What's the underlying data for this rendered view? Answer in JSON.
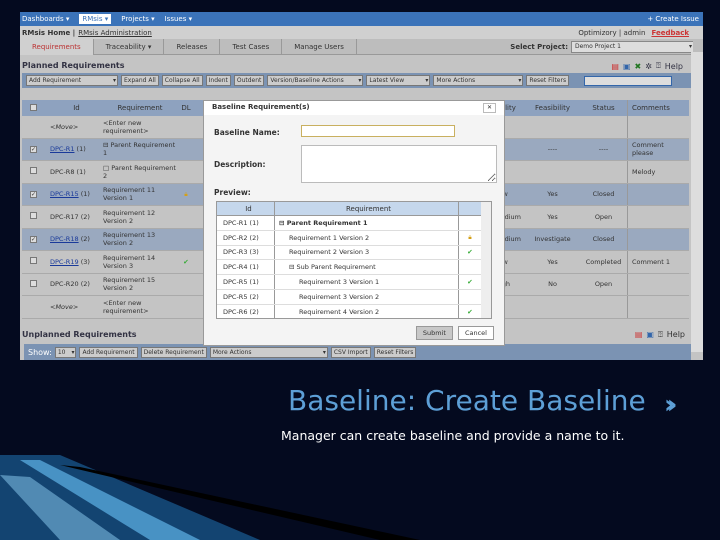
{
  "nav": {
    "items": [
      "Dashboards ▾",
      "RMsis ▾",
      "Projects ▾",
      "Issues ▾"
    ],
    "create_issue": "+ Create Issue"
  },
  "header": {
    "home": "RMsis Home",
    "admin": "RMsis Administration",
    "user": "Optimizory | admin",
    "feedback": "Feedback"
  },
  "tabs": [
    "Requirements",
    "Traceability ▾",
    "Releases",
    "Test Cases",
    "Manage Users"
  ],
  "project": {
    "label": "Select Project:",
    "value": "Demo Project 1"
  },
  "planned": {
    "title": "Planned Requirements",
    "help": "Help",
    "toolbar": {
      "add": "Add Requirement",
      "expand": "Expand All",
      "collapse": "Collapse All",
      "indent": "Indent",
      "outdent": "Outdent",
      "version": "Version/Baseline Actions",
      "view": "Latest View",
      "more": "More Actions",
      "reset": "Reset Filters"
    },
    "columns": [
      "Id",
      "Requirement",
      "DL",
      "icality",
      "Feasibility",
      "Status",
      "Comments"
    ],
    "rows": [
      {
        "id": "",
        "req": "<Enter new requirement>",
        "move": "<Move>",
        "sel": false
      },
      {
        "id": "DPC-R1",
        "ver": "(1)",
        "req": "⊟ Parent Requirement 1",
        "crit": "----",
        "feas": "----",
        "status": "----",
        "comment": "Comment please",
        "sel": true,
        "link": true
      },
      {
        "id": "DPC-R8",
        "ver": "(1)",
        "req": "□ Parent Requirement 2",
        "comment": "Melody",
        "sel": false
      },
      {
        "id": "DPC-R15",
        "ver": "(1)",
        "req": "Requirement 11 Version 1",
        "dl": "lock",
        "crit": "Low",
        "feas": "Yes",
        "status": "Closed",
        "sel": true,
        "link": true
      },
      {
        "id": "DPC-R17",
        "ver": "(2)",
        "req": "Requirement 12 Version 2",
        "crit": "Medium",
        "feas": "Yes",
        "status": "Open",
        "sel": false
      },
      {
        "id": "DPC-R18",
        "ver": "(2)",
        "req": "Requirement 13 Version 2",
        "crit": "Medium",
        "feas": "Investigate",
        "status": "Closed",
        "sel": true,
        "link": true
      },
      {
        "id": "DPC-R19",
        "ver": "(3)",
        "req": "Requirement 14 Version 3",
        "dl": "check",
        "crit": "Low",
        "feas": "Yes",
        "status": "Completed",
        "comment": "Comment 1",
        "sel": false,
        "link": true
      },
      {
        "id": "DPC-R20",
        "ver": "(2)",
        "req": "Requirement 15 Version 2",
        "crit": "High",
        "feas": "No",
        "status": "Open",
        "sel": false
      },
      {
        "id": "",
        "req": "<Enter new requirement>",
        "move": "<Move>",
        "sel": false
      }
    ]
  },
  "dialog": {
    "title": "Baseline Requirement(s)",
    "name_label": "Baseline Name:",
    "name_value": "",
    "desc_label": "Description:",
    "preview_label": "Preview:",
    "cols": [
      "Id",
      "Requirement"
    ],
    "rows": [
      {
        "id": "DPC-R1 (1)",
        "req": "⊟ Parent Requirement 1",
        "bold": true,
        "indent": 0,
        "icon": ""
      },
      {
        "id": "DPC-R2 (2)",
        "req": "Requirement 1 Version 2",
        "indent": 1,
        "icon": "lock"
      },
      {
        "id": "DPC-R3 (3)",
        "req": "Requirement 2 Version 3",
        "indent": 1,
        "icon": "check"
      },
      {
        "id": "DPC-R4 (1)",
        "req": "⊟ Sub Parent Requirement",
        "indent": 1,
        "icon": ""
      },
      {
        "id": "DPC-R5 (1)",
        "req": "Requirement 3 Version 1",
        "indent": 2,
        "icon": "check"
      },
      {
        "id": "DPC-R5 (2)",
        "req": "Requirement 3 Version 2",
        "indent": 2,
        "icon": ""
      },
      {
        "id": "DPC-R6 (2)",
        "req": "Requirement 4 Version 2",
        "indent": 2,
        "icon": "check"
      }
    ],
    "submit": "Submit",
    "cancel": "Cancel"
  },
  "unplanned": {
    "title": "Unplanned Requirements",
    "help": "Help",
    "show": "Show:",
    "show_value": "10",
    "add": "Add Requirement",
    "delete": "Delete Requirement",
    "more": "More Actions",
    "csv": "CSV Import",
    "reset": "Reset Filters"
  },
  "slide": {
    "title": "Baseline: Create Baseline",
    "subtitle": "Manager can create baseline and provide a name to it."
  },
  "colors": {
    "slide_bg": "#040a1f",
    "title": "#5d9fd6",
    "nav": "#3b73b9",
    "selected_row": "#9aa9bf"
  }
}
